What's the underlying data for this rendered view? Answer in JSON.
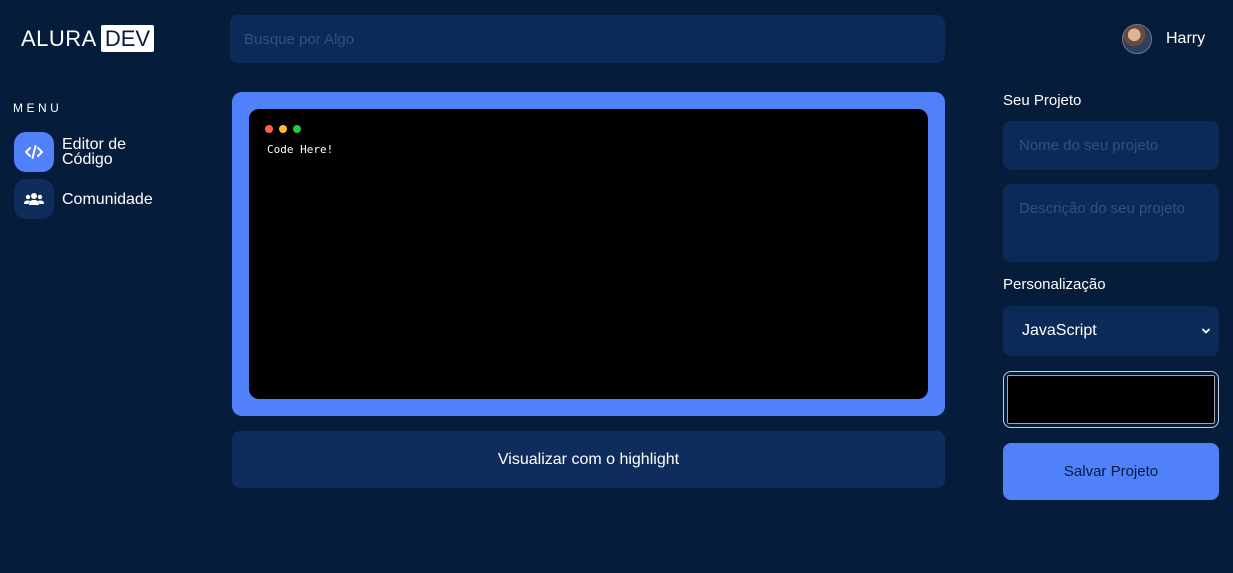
{
  "logo": {
    "text": "ALURA",
    "badge": "DEV"
  },
  "search": {
    "placeholder": "Busque por Algo"
  },
  "user": {
    "name": "Harry"
  },
  "menu": {
    "title": "MENU",
    "items": [
      {
        "label": "Editor de Código",
        "icon": "code-icon",
        "active": true
      },
      {
        "label": "Comunidade",
        "icon": "users-icon",
        "active": false
      }
    ]
  },
  "editor": {
    "code": "Code Here!",
    "window_dots": [
      "#ff5f56",
      "#ffbd2e",
      "#27c93f"
    ],
    "frame_color": "#5081fb"
  },
  "highlight_button": {
    "label": "Visualizar com o highlight"
  },
  "project": {
    "title": "Seu Projeto",
    "name_placeholder": "Nome do seu projeto",
    "description_placeholder": "Descrição do seu projeto"
  },
  "customization": {
    "title": "Personalização",
    "language": "JavaScript",
    "color": "#000000"
  },
  "save_button": {
    "label": "Salvar Projeto"
  },
  "colors": {
    "background": "#051d3b",
    "accent": "#5081fb",
    "field": "#0b2a57"
  }
}
